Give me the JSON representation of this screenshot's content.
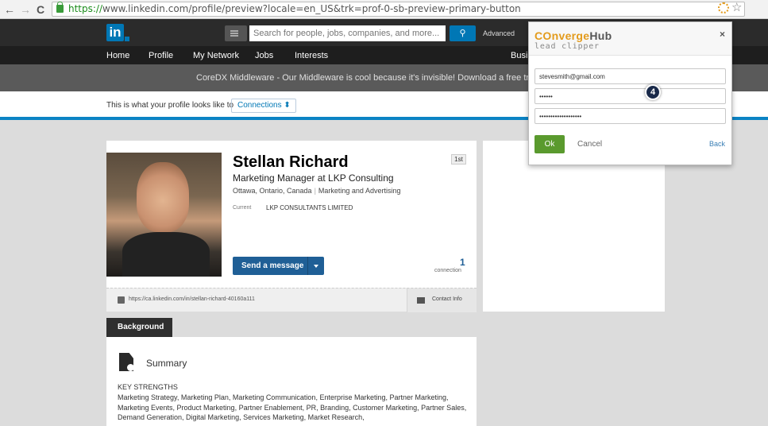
{
  "browser": {
    "url_https": "https://",
    "url_rest": "www.linkedin.com/profile/preview?locale=en_US&trk=prof-0-sb-preview-primary-button",
    "back": "←",
    "forward": "→",
    "reload": "C"
  },
  "header": {
    "logo": "in",
    "search_placeholder": "Search for people, jobs, companies, and more...",
    "advanced": "Advanced"
  },
  "nav": {
    "items": [
      "Home",
      "Profile",
      "My Network",
      "Jobs",
      "Interests",
      "Busin"
    ]
  },
  "ad": {
    "text": "CoreDX Middleware - Our Middleware is cool because it's invisible! Download a free trial. |"
  },
  "preview": {
    "label": "This is what your profile looks like to",
    "select": "Connections ⬍"
  },
  "profile": {
    "name": "Stellan Richard",
    "headline": "Marketing Manager at LKP Consulting",
    "location": "Ottawa, Ontario, Canada",
    "industry": "Marketing and Advertising",
    "current_label": "Current",
    "current_value": "LKP CONSULTANTS LIMITED",
    "degree": "1st",
    "send_message": "Send a message",
    "connections_count": "1",
    "connections_label": "connection",
    "url": "https://ca.linkedin.com/in/stellan-richard-40160a111",
    "contact_info": "Contact Info"
  },
  "background": {
    "tab": "Background",
    "summary_title": "Summary",
    "key_strengths": "KEY STRENGTHS",
    "summary_text": "Marketing Strategy, Marketing Plan, Marketing Communication, Enterprise Marketing, Partner Marketing, Marketing Events, Product Marketing, Partner Enablement, PR, Branding, Customer Marketing, Partner Sales, Demand Generation, Digital Marketing, Services Marketing, Market Research,"
  },
  "popup": {
    "brand_c": "C",
    "brand_o": "O",
    "brand_nverge": "nverge",
    "brand_hub": "Hub",
    "subtitle": "lead clipper",
    "close": "×",
    "email": "stevesmith@gmail.com",
    "password": "••••••",
    "token": "•••••••••••••••••••",
    "step": "4",
    "ok": "Ok",
    "cancel": "Cancel",
    "back": "Back"
  },
  "colors": {
    "linkedin_blue": "#0077b5",
    "convergehub_orange": "#e39b1c",
    "ok_green": "#5a9a2e"
  }
}
